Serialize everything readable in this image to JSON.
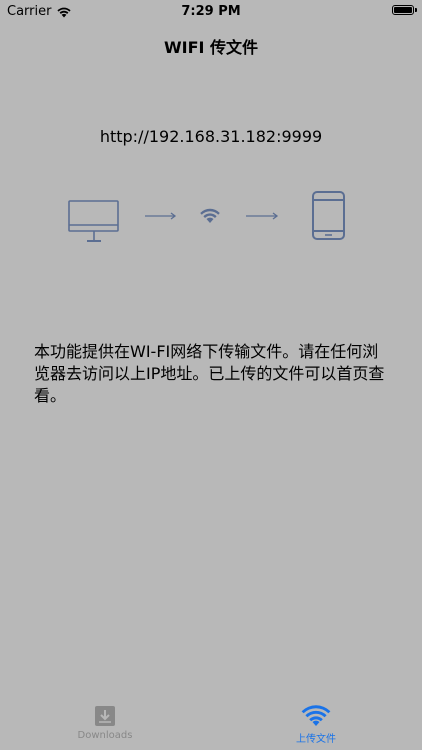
{
  "status_bar": {
    "carrier": "Carrier",
    "time": "7:29 PM"
  },
  "nav": {
    "title": "WIFI 传文件"
  },
  "main": {
    "url": "http://192.168.31.182:9999",
    "description": "本功能提供在WI-FI网络下传输文件。请在任何浏览器去访问以上IP地址。已上传的文件可以首页查看。",
    "diagram": {
      "icons": [
        "desktop-monitor-icon",
        "arrow-right-icon",
        "wifi-icon",
        "arrow-right-icon",
        "tablet-icon"
      ],
      "icon_color": "#5b6e92"
    }
  },
  "tabbar": {
    "tabs": [
      {
        "label": "Downloads",
        "icon": "download-tray-icon",
        "selected": false,
        "color": "#888888"
      },
      {
        "label": "上传文件",
        "icon": "wifi-icon",
        "selected": true,
        "color": "#1a73e8"
      }
    ]
  },
  "colors": {
    "background": "#b8b8b8",
    "accent": "#1a73e8",
    "inactive": "#888888"
  }
}
